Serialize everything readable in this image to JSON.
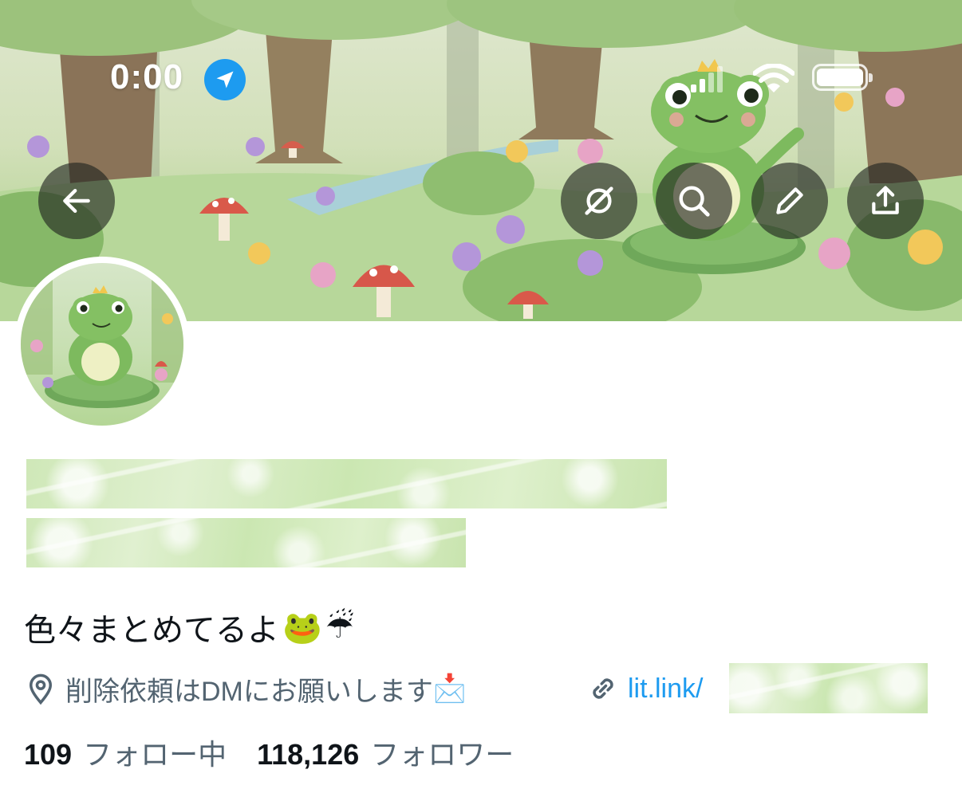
{
  "status_bar": {
    "time": "0:00",
    "location_icon": "location-arrow-icon",
    "signal_icon": "cellular-signal-icon",
    "wifi_icon": "wifi-icon",
    "battery_icon": "battery-icon"
  },
  "header": {
    "banner_image": "frog-forest-banner",
    "back_icon": "back-arrow-icon",
    "grok_icon": "grok-icon",
    "search_icon": "search-icon",
    "edit_icon": "pencil-icon",
    "share_icon": "share-icon"
  },
  "profile": {
    "avatar": "frog-avatar",
    "bio_text": "色々まとめてるよ",
    "bio_emoji_1": "🐸",
    "bio_emoji_2": "☔",
    "location": "削除依頼はDMにお願いします",
    "location_emoji": "📩",
    "link_prefix": "lit.link/",
    "following_count": "109",
    "following_label": "フォロー中",
    "followers_count": "118,126",
    "followers_label": "フォロワー"
  },
  "colors": {
    "accent": "#1d9bf0",
    "secondary_text": "#536471",
    "primary_text": "#0f1419"
  }
}
